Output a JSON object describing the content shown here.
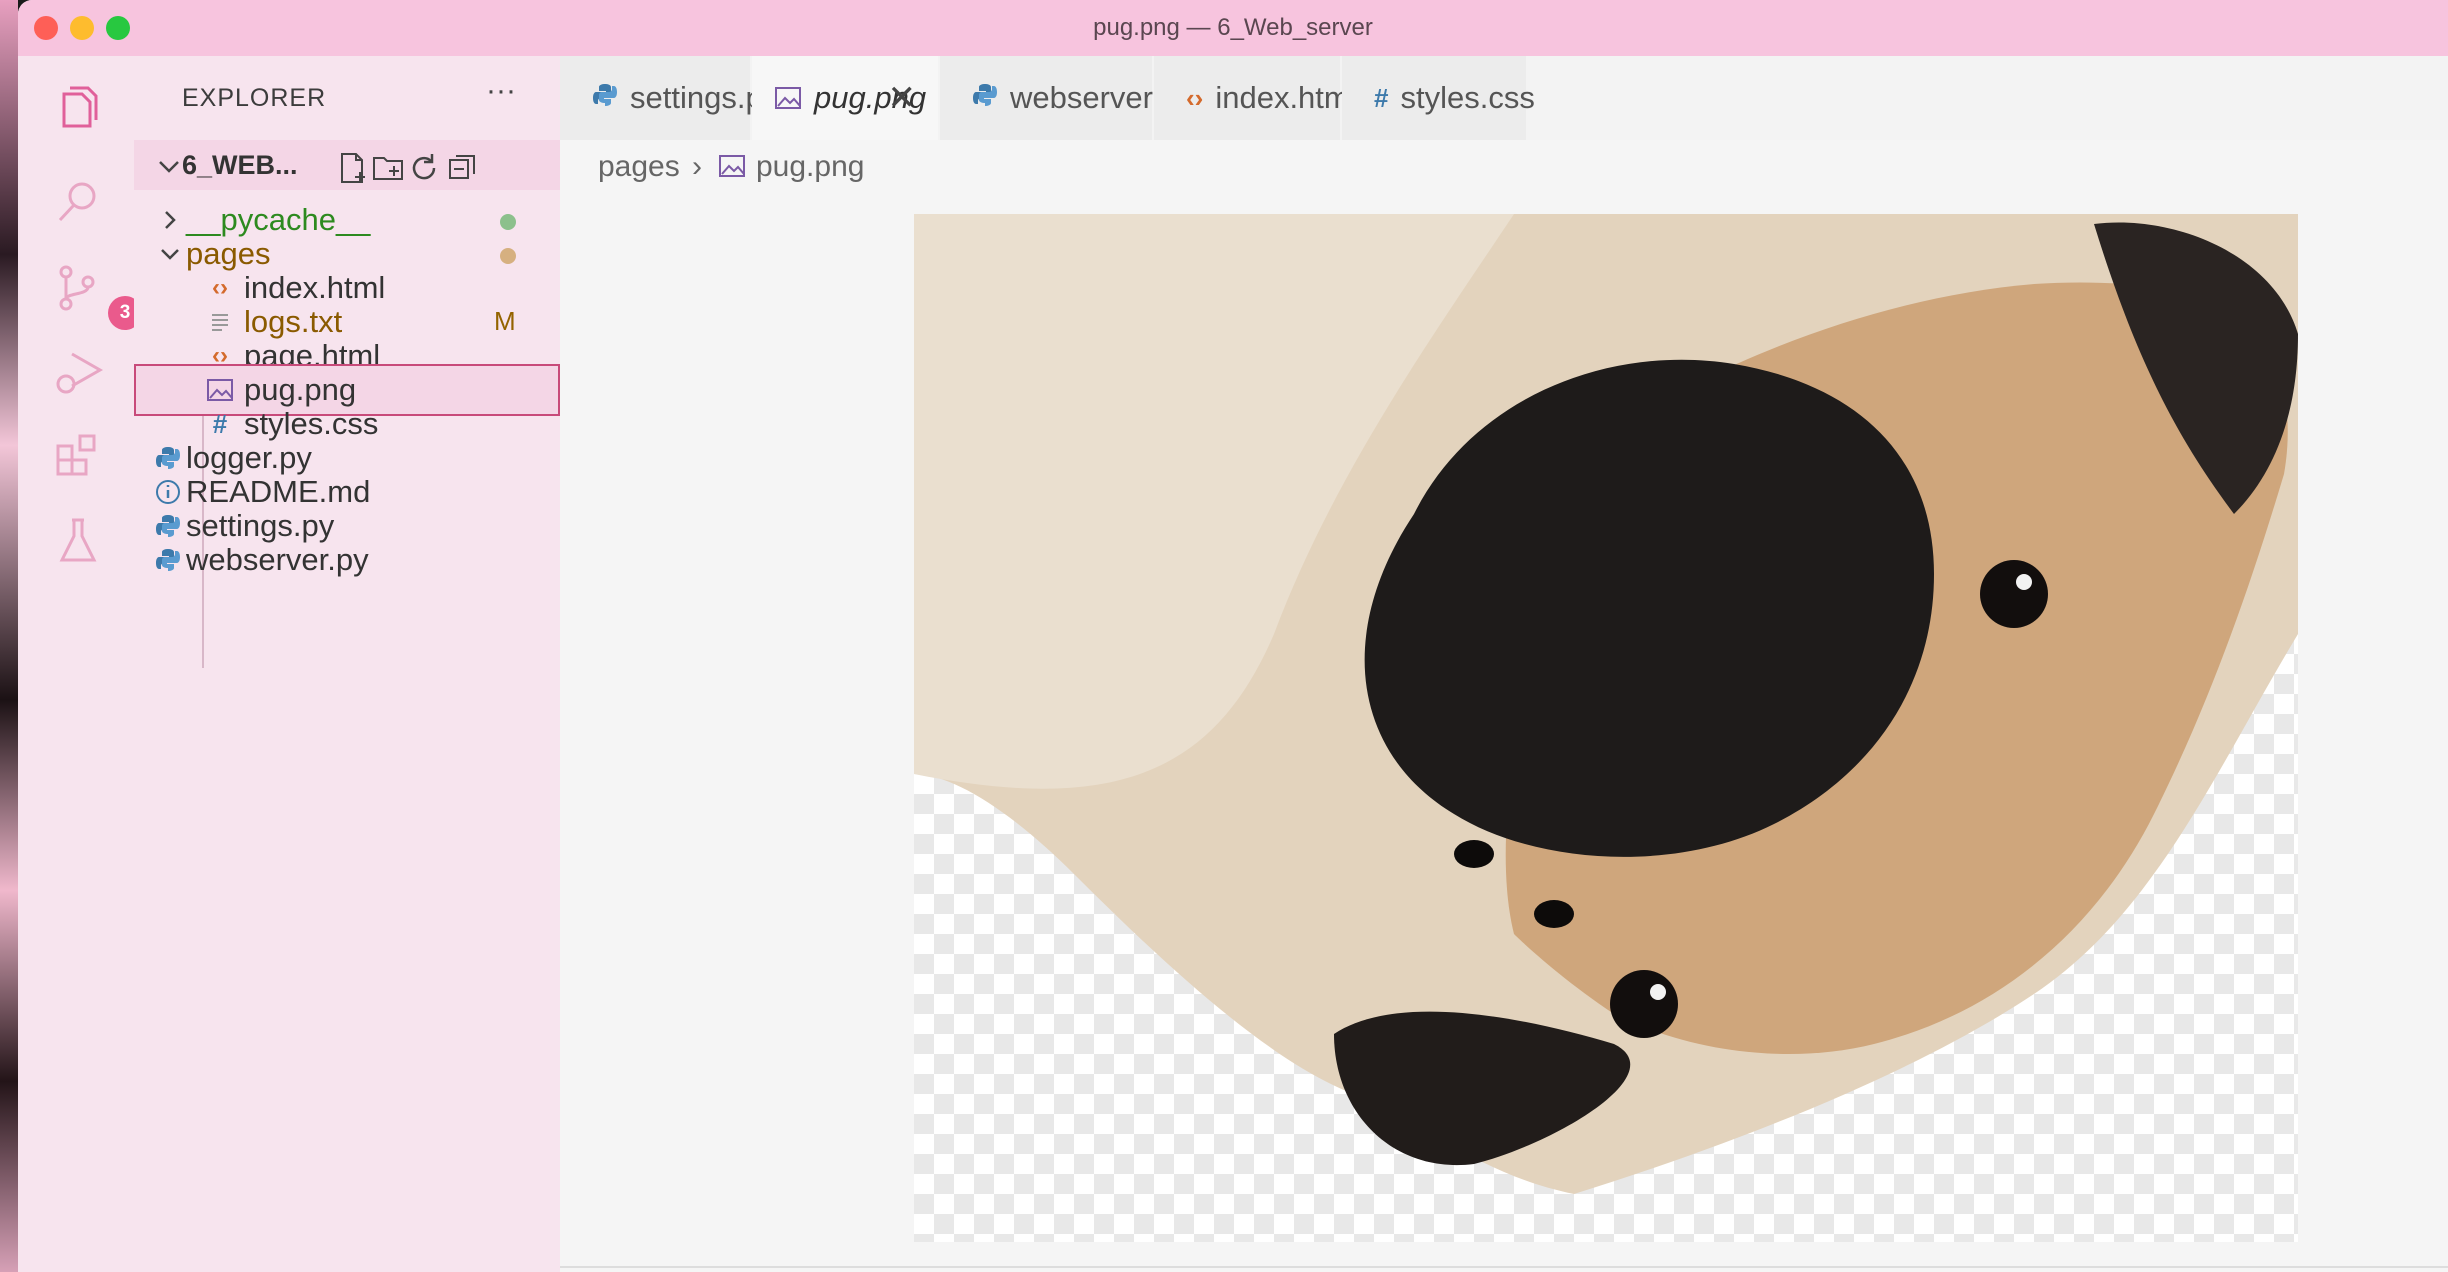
{
  "window": {
    "title": "pug.png — 6_Web_server"
  },
  "activity_bar": {
    "items": [
      {
        "name": "explorer-icon"
      },
      {
        "name": "search-icon"
      },
      {
        "name": "source-control-icon",
        "badge": "3"
      },
      {
        "name": "run-debug-icon"
      },
      {
        "name": "extensions-icon"
      },
      {
        "name": "testing-icon"
      }
    ]
  },
  "sidebar": {
    "title": "EXPLORER",
    "more": "···",
    "folder": "6_WEB...",
    "items": [
      {
        "label": "__pycache__",
        "icon": "chevron-right-icon",
        "color": "#2d8a1f",
        "status_dot": "#8cc08c"
      },
      {
        "label": "pages",
        "icon": "chevron-down-icon",
        "color": "#8a5a00",
        "status_dot": "#d6b080"
      },
      {
        "label": "index.html",
        "icon": "html-icon"
      },
      {
        "label": "logs.txt",
        "icon": "text-file-icon",
        "color": "#8a5a00",
        "status": "M"
      },
      {
        "label": "page.html",
        "icon": "html-icon"
      },
      {
        "label": "pug.png",
        "icon": "image-icon",
        "selected": true
      },
      {
        "label": "styles.css",
        "icon": "css-icon"
      },
      {
        "label": "logger.py",
        "icon": "python-icon"
      },
      {
        "label": "README.md",
        "icon": "info-icon"
      },
      {
        "label": "settings.py",
        "icon": "python-icon"
      },
      {
        "label": "webserver.py",
        "icon": "python-icon"
      }
    ]
  },
  "tabs": [
    {
      "label": "settings.py",
      "icon": "python-icon"
    },
    {
      "label": "pug.png",
      "icon": "image-icon",
      "active": true,
      "close": "✕"
    },
    {
      "label": "webserver.py",
      "icon": "python-icon"
    },
    {
      "label": "index.html",
      "icon": "html-icon"
    },
    {
      "label": "styles.css",
      "icon": "css-icon"
    }
  ],
  "breadcrumbs": {
    "folder": "pages",
    "separator": "›",
    "file": "pug.png"
  },
  "colors": {
    "titlebar": "#f7c4de",
    "sidebar": "#f7e4ee",
    "accent": "#ea5a8c",
    "python": "#3d7aab",
    "html": "#d46a2c",
    "css": "#3d7aab",
    "image": "#7b5aa6"
  }
}
